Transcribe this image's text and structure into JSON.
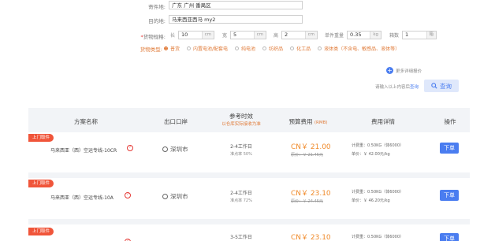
{
  "form": {
    "origin_label": "寄件地:",
    "origin_value": "广东 广州 番禺区",
    "dest_label": "目的地:",
    "dest_value": "马来西亚西马 my2",
    "size_label": "货物规格:",
    "length_label": "长",
    "length_value": "10",
    "width_label": "宽",
    "width_value": "5",
    "height_label": "高",
    "height_value": "2",
    "unit_cm": "cm",
    "weight_label": "单件重量",
    "weight_value": "0.35",
    "unit_kg": "kg",
    "count_label": "箱数",
    "count_value": "1",
    "count_unit": "箱",
    "goods_label": "货物类型:",
    "goods_types": [
      {
        "label": "普货",
        "selected": true
      },
      {
        "label": "内置电池/配套电",
        "selected": false
      },
      {
        "label": "纯电池",
        "selected": false
      },
      {
        "label": "纺织品",
        "selected": false
      },
      {
        "label": "化工品",
        "selected": false
      },
      {
        "label": "液体类（不含电、敏感品、液体等）",
        "selected": false
      }
    ]
  },
  "extra_link": "更多详细报价",
  "search_hint": "请输入以上内容后",
  "search_hint_link": "查询",
  "search_button": "查询",
  "table": {
    "headers": {
      "plan": "方案名称",
      "port": "出口口岸",
      "time": "参考时效",
      "time_sub": "以仓库实际接收为准",
      "cost": "预算费用",
      "cost_sub": "(RMB)",
      "detail": "费用详情",
      "action": "操作"
    },
    "rows": [
      {
        "tag": "上门取件",
        "route": "马来西亚（西）空运专线-10CR",
        "port": "深圳市",
        "days": "2-4工作日",
        "on_time": "准点率 50%",
        "price": "CN￥ 21.00",
        "orig": "原价：￥ 21.45元",
        "detail1": "计费重：0.50KG（体6000）",
        "detail2": "单价：￥ 42.00元/kg",
        "order": "下单"
      },
      {
        "tag": "上门取件",
        "route": "马来西亚（西）空运专线-10A",
        "port": "深圳市",
        "days": "2-4工作日",
        "on_time": "准点率 72%",
        "price": "CN￥ 23.10",
        "orig": "原价：￥ 24.45元",
        "detail1": "计费重：0.50KG（体6000）",
        "detail2": "单价：￥ 46.20元/kg",
        "order": "下单"
      },
      {
        "tag": "上门取件",
        "route": "",
        "port": "",
        "days": "3-5工作日",
        "on_time": "",
        "price": "CN￥ 23.10",
        "orig": "",
        "detail1": "计费重：0.50KG（体6000）",
        "detail2": "",
        "order": "下单"
      }
    ]
  },
  "colors": {
    "accent_orange": "#e07b39",
    "tag_red": "#f0553a",
    "order_blue": "#4a7df0",
    "header_bg": "#f2f4f7"
  }
}
